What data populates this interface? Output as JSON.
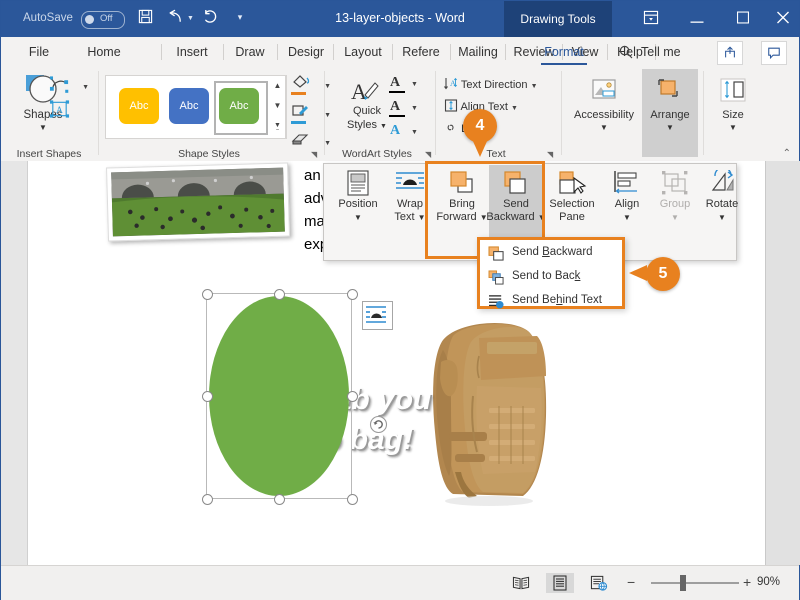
{
  "titlebar": {
    "autosave_label": "AutoSave",
    "autosave_state": "Off",
    "document_title": "13-layer-objects - Word",
    "contextual_tab": "Drawing Tools",
    "icons": {
      "save": "save-icon",
      "undo": "undo-icon",
      "redo": "redo-icon",
      "customize_qat": "customize-quick-access-toolbar-icon",
      "ribbon_display": "ribbon-display-options-icon",
      "minimize": "minimize-icon",
      "maximize": "maximize-icon",
      "close": "close-icon"
    },
    "accent_color": "#2b579a",
    "contextual_color": "#1e4278"
  },
  "tabs": [
    {
      "label": "File",
      "active": false
    },
    {
      "label": "Home",
      "active": false
    },
    {
      "label": "Insert",
      "active": false
    },
    {
      "label": "Draw",
      "active": false
    },
    {
      "label": "Desigr",
      "active": false
    },
    {
      "label": "Layout",
      "active": false
    },
    {
      "label": "Refere",
      "active": false
    },
    {
      "label": "Mailing",
      "active": false
    },
    {
      "label": "Review",
      "active": false
    },
    {
      "label": "View",
      "active": false
    },
    {
      "label": "Help",
      "active": false
    },
    {
      "label": "Format",
      "active": true
    }
  ],
  "tellme": {
    "label": "Tell me",
    "icon": "search-icon"
  },
  "titlebar_right_buttons": [
    {
      "name": "share-button",
      "icon": "share-icon"
    },
    {
      "name": "comments-button",
      "icon": "comment-icon"
    }
  ],
  "ribbon": {
    "groups": [
      {
        "label": "Insert Shapes"
      },
      {
        "label": "Shape Styles"
      },
      {
        "label": "WordArt Styles"
      },
      {
        "label": "Text"
      },
      {
        "label": "Arrange"
      },
      {
        "label": "Size"
      }
    ],
    "insert_shapes": {
      "shapes_label": "Shapes",
      "edit_shape_icon": "edit-shape-icon",
      "text_box_icon": "draw-text-box-icon"
    },
    "shape_styles": {
      "swatches": [
        {
          "text": "Abc",
          "color": "#ffc000",
          "selected": false
        },
        {
          "text": "Abc",
          "color": "#4472c4",
          "selected": false
        },
        {
          "text": "Abc",
          "color": "#70ad47",
          "selected": true
        }
      ],
      "shape_fill_icon": "shape-fill-icon",
      "shape_outline_icon": "shape-outline-icon",
      "shape_effects_icon": "shape-effects-icon",
      "fill_accent": "#e8811f",
      "outline_accent": "#2e9bd6"
    },
    "wordart_styles": {
      "quick_styles_line1": "Quick",
      "quick_styles_line2": "Styles",
      "text_fill_icon": "text-fill-icon",
      "text_outline_icon": "text-outline-icon",
      "text_effects_icon": "text-effects-icon"
    },
    "text_group": {
      "items": [
        {
          "label": "Text Direction",
          "icon": "text-direction-icon",
          "has_caret": true
        },
        {
          "label": "Align Text",
          "icon": "align-text-icon",
          "has_caret": true
        },
        {
          "label": "Link",
          "icon": "link-icon",
          "has_caret": false
        }
      ]
    },
    "accessibility": {
      "label": "Accessibility",
      "icon": "accessibility-check-icon"
    },
    "arrange": {
      "label": "Arrange",
      "icon": "arrange-icon",
      "selected": true
    },
    "size": {
      "label": "Size",
      "icon": "size-icon"
    },
    "collapse_ribbon_icon": "chevron-up-icon"
  },
  "arrange_panel": {
    "buttons": [
      {
        "label_line1": "Position",
        "label_line2": "",
        "icon": "position-icon",
        "caret": true,
        "disabled": false,
        "highlighted": false
      },
      {
        "label_line1": "Wrap",
        "label_line2": "Text",
        "icon": "wrap-text-icon",
        "caret": true,
        "disabled": false,
        "highlighted": false
      },
      {
        "label_line1": "Bring",
        "label_line2": "Forward",
        "icon": "bring-forward-icon",
        "caret": true,
        "disabled": false,
        "highlighted": true
      },
      {
        "label_line1": "Send",
        "label_line2": "Backward",
        "icon": "send-backward-icon",
        "caret": true,
        "disabled": false,
        "highlighted": true,
        "active": true
      },
      {
        "label_line1": "Selection",
        "label_line2": "Pane",
        "icon": "selection-pane-icon",
        "caret": false,
        "disabled": false,
        "highlighted": false
      },
      {
        "label_line1": "Align",
        "label_line2": "",
        "icon": "align-objects-icon",
        "caret": true,
        "disabled": false,
        "highlighted": false
      },
      {
        "label_line1": "Group",
        "label_line2": "",
        "icon": "group-objects-icon",
        "caret": true,
        "disabled": true,
        "highlighted": false
      },
      {
        "label_line1": "Rotate",
        "label_line2": "",
        "icon": "rotate-objects-icon",
        "caret": true,
        "disabled": false,
        "highlighted": false
      }
    ],
    "highlight_color": "#e8811f"
  },
  "send_backward_menu": {
    "items": [
      {
        "label": "Send Backward",
        "accel": "B",
        "icon": "send-backward-icon"
      },
      {
        "label": "Send to Back",
        "accel": "k",
        "icon": "send-to-back-icon"
      },
      {
        "label": "Send Behind Text",
        "accel": "h",
        "icon": "send-behind-text-icon"
      }
    ],
    "border_color": "#e8811f"
  },
  "callouts": [
    {
      "number": "4",
      "color": "#e8811f"
    },
    {
      "number": "5",
      "color": "#e8811f"
    }
  ],
  "document": {
    "body_lines": [
      "an",
      "adv",
      "ma",
      "exp"
    ],
    "wordart_line1": "rab you",
    "wordart_line2": "o bag!",
    "wordart_color": "#ffffff",
    "ellipse_color": "#70ad47",
    "photo_alt": "photo-people-on-grass-by-bridge",
    "backpack_alt": "tan-tactical-backpack",
    "layout_options_icon": "layout-options-icon"
  },
  "statusbar": {
    "view_buttons": [
      {
        "name": "read-mode-button",
        "icon": "read-mode-icon",
        "selected": false
      },
      {
        "name": "print-layout-button",
        "icon": "print-layout-icon",
        "selected": true
      },
      {
        "name": "web-layout-button",
        "icon": "web-layout-icon",
        "selected": false
      }
    ],
    "zoom_out_label": "−",
    "zoom_in_label": "+",
    "zoom_level": "90%"
  }
}
